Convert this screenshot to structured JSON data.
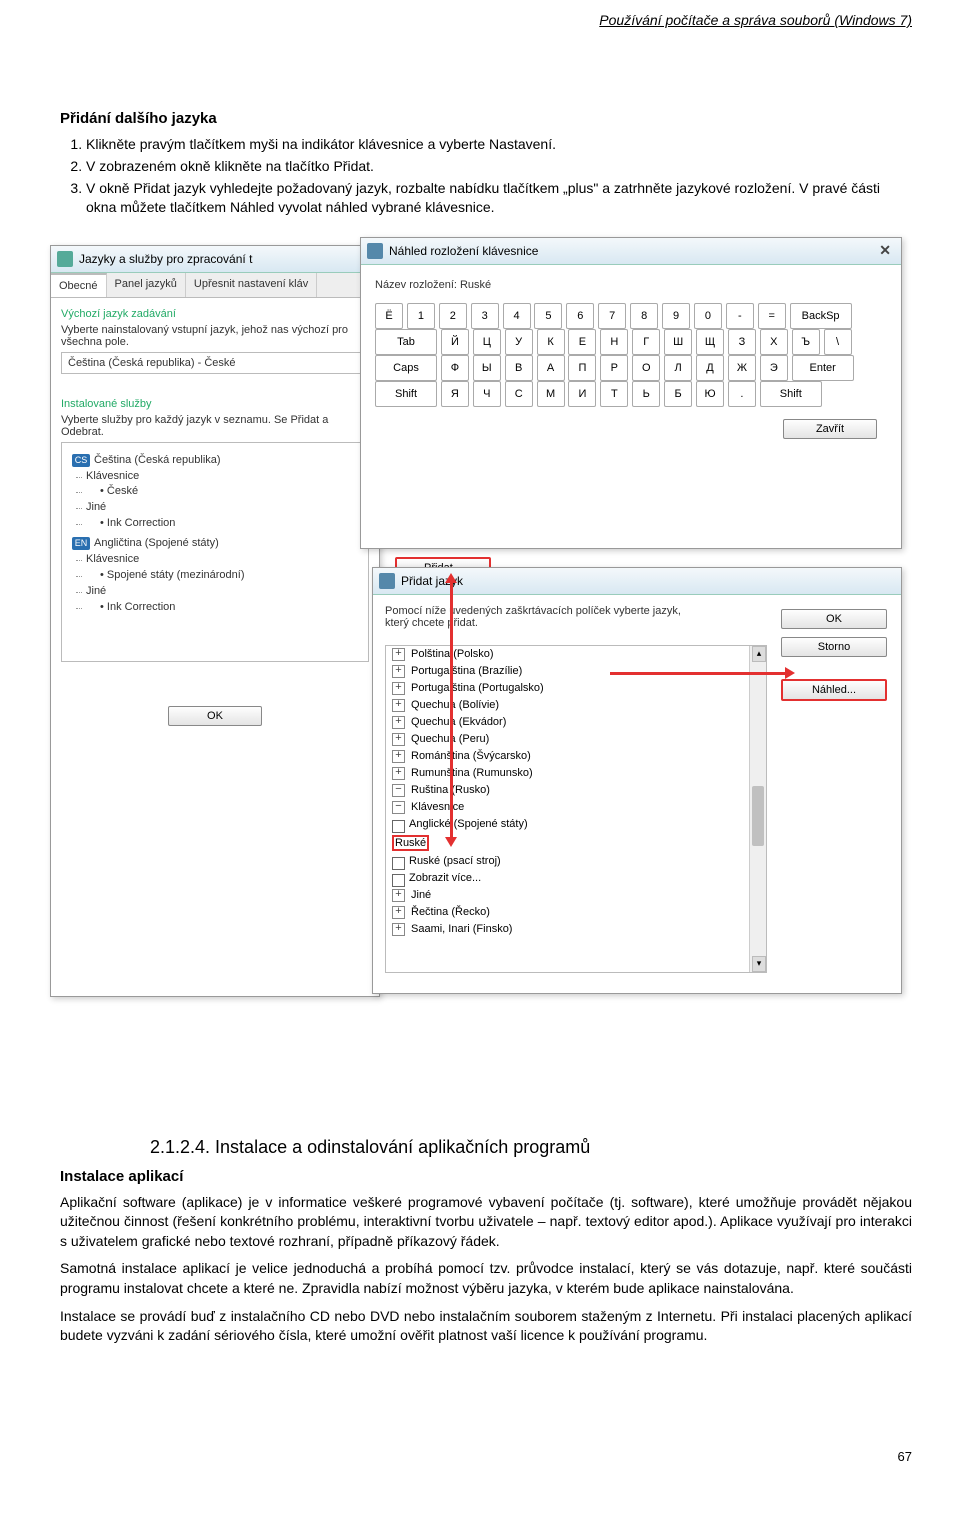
{
  "header": "Používání počítače a správa souborů (Windows 7)",
  "h2": "Přidání dalšího jazyka",
  "steps": [
    "Klikněte pravým tlačítkem myši na indikátor klávesnice a vyberte Nastavení.",
    "V zobrazeném okně klikněte na tlačítko Přidat.",
    "V okně Přidat jazyk vyhledejte požadovaný jazyk, rozbalte nabídku tlačítkem „plus\" a zatrhněte jazykové rozložení. V pravé části okna můžete tlačítkem Náhled vyvolat náhled vybrané klávesnice."
  ],
  "langwin": {
    "title": "Jazyky a služby pro zpracování t",
    "tabs": [
      "Obecné",
      "Panel jazyků",
      "Upřesnit nastavení kláv"
    ],
    "sec1_title": "Výchozí jazyk zadávání",
    "sec1_desc": "Vyberte nainstalovaný vstupní jazyk, jehož nas výchozí pro všechna pole.",
    "sec1_value": "Čeština (Česká republika) - České",
    "sec2_title": "Instalované služby",
    "sec2_desc": "Vyberte služby pro každý jazyk v seznamu. Se Přidat a Odebrat.",
    "tree": {
      "cs": {
        "badge": "CS",
        "label": "Čeština (Česká republika)",
        "kbd": "Klávesnice",
        "items": [
          "České"
        ],
        "jine": "Jiné",
        "ink": "Ink Correction"
      },
      "en": {
        "badge": "EN",
        "label": "Angličtina (Spojené státy)",
        "kbd": "Klávesnice",
        "items": [
          "Spojené státy (mezinárodní)"
        ],
        "jine": "Jiné",
        "ink": "Ink Correction"
      }
    },
    "ok": "OK",
    "add_btn": "Přidat..."
  },
  "kbwin": {
    "title": "Náhled rozložení klávesnice",
    "label": "Název rozložení: Ruské",
    "close": "Zavřít",
    "rows": [
      [
        "Ë",
        "1",
        "2",
        "3",
        "4",
        "5",
        "6",
        "7",
        "8",
        "9",
        "0",
        "-",
        "=",
        "BackSp"
      ],
      [
        "Tab",
        "Й",
        "Ц",
        "У",
        "К",
        "Е",
        "Н",
        "Г",
        "Ш",
        "Щ",
        "З",
        "Х",
        "Ъ",
        "\\"
      ],
      [
        "Caps",
        "Ф",
        "Ы",
        "В",
        "А",
        "П",
        "Р",
        "О",
        "Л",
        "Д",
        "Ж",
        "Э",
        "Enter"
      ],
      [
        "Shift",
        "Я",
        "Ч",
        "С",
        "М",
        "И",
        "Т",
        "Ь",
        "Б",
        "Ю",
        ".",
        "Shift"
      ]
    ]
  },
  "addwin": {
    "title": "Přidat jazyk",
    "desc": "Pomocí níže uvedených zaškrtávacích políček vyberte jazyk, který chcete přidat.",
    "ok": "OK",
    "cancel": "Storno",
    "preview": "Náhled...",
    "list": [
      {
        "t": "Polština (Polsko)",
        "exp": "+",
        "lvl": 1
      },
      {
        "t": "Portugalština (Brazílie)",
        "exp": "+",
        "lvl": 1
      },
      {
        "t": "Portugalština (Portugalsko)",
        "exp": "+",
        "lvl": 1
      },
      {
        "t": "Quechua (Bolívie)",
        "exp": "+",
        "lvl": 1
      },
      {
        "t": "Quechua (Ekvádor)",
        "exp": "+",
        "lvl": 1
      },
      {
        "t": "Quechua (Peru)",
        "exp": "+",
        "lvl": 1
      },
      {
        "t": "Románština (Švýcarsko)",
        "exp": "+",
        "lvl": 1
      },
      {
        "t": "Rumunština (Rumunsko)",
        "exp": "+",
        "lvl": 1
      },
      {
        "t": "Ruština (Rusko)",
        "exp": "−",
        "lvl": 1
      },
      {
        "t": "Klávesnice",
        "exp": "−",
        "lvl": 2
      },
      {
        "t": "Anglické (Spojené státy)",
        "chk": "off",
        "lvl": 3
      },
      {
        "t": "Ruské",
        "chk": "on",
        "lvl": 3,
        "hl": true
      },
      {
        "t": "Ruské (psací stroj)",
        "chk": "off",
        "lvl": 3
      },
      {
        "t": "Zobrazit více...",
        "chk": "off",
        "lvl": 3
      },
      {
        "t": "Jiné",
        "exp": "+",
        "lvl": 2
      },
      {
        "t": "Řečtina (Řecko)",
        "exp": "+",
        "lvl": 1
      },
      {
        "t": "Saami, Inari (Finsko)",
        "exp": "+",
        "lvl": 1
      }
    ]
  },
  "section2": {
    "num_title": "2.1.2.4. Instalace a odinstalování aplikačních programů",
    "subhead": "Instalace aplikací",
    "p1": "Aplikační software (aplikace) je v informatice veškeré programové vybavení počítače (tj. software), které umožňuje provádět nějakou užitečnou činnost (řešení konkrétního problému, interaktivní tvorbu uživatele – např. textový editor apod.). Aplikace využívají pro interakci s uživatelem grafické nebo textové rozhraní, případně příkazový řádek.",
    "p2": "Samotná instalace aplikací je velice jednoduchá a probíhá pomocí tzv. průvodce instalací, který se vás dotazuje, např. které součásti programu instalovat chcete a které ne. Zpravidla nabízí možnost výběru jazyka, v kterém bude aplikace nainstalována.",
    "p3": "Instalace se provádí buď z instalačního CD nebo DVD nebo instalačním souborem staženým z Internetu. Při instalaci placených aplikací budete vyzváni k zadání sériového čísla, které umožní ověřit platnost vaší licence k používání programu."
  },
  "pagenum": "67"
}
